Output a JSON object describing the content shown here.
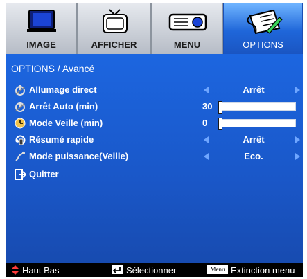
{
  "tabs": [
    {
      "label": "IMAGE",
      "icon": "monitor-icon",
      "active": false
    },
    {
      "label": "AFFICHER",
      "icon": "tv-icon",
      "active": false
    },
    {
      "label": "MENU",
      "icon": "projector-icon",
      "active": false
    },
    {
      "label": "OPTIONS",
      "icon": "options-icon",
      "active": true
    }
  ],
  "panel": {
    "title": "OPTIONS / Avancé"
  },
  "rows": [
    {
      "label": "Allumage direct",
      "icon": "direct-power-icon",
      "value": "Arrêt"
    },
    {
      "label": "Arrêt Auto (min)",
      "icon": "auto-off-icon",
      "number": "30",
      "level": 0.0
    },
    {
      "label": "Mode Veille (min)",
      "icon": "sleep-timer-icon",
      "number": "0",
      "level": 0.0
    },
    {
      "label": "Résumé rapide",
      "icon": "quick-resume-icon",
      "value": "Arrêt"
    },
    {
      "label": "Mode puissance(Veille)",
      "icon": "power-mode-icon",
      "value": "Eco."
    },
    {
      "label": "Quitter",
      "icon": "exit-icon"
    }
  ],
  "footer": {
    "nav": "Haut Bas",
    "select": "Sélectionner",
    "menu_key": "Menu",
    "exit": "Extinction menu"
  },
  "colors": {
    "accent": "#1a5fd6",
    "arrow": "#6fa6ff",
    "footer_arrow": "#ff3b3b"
  }
}
